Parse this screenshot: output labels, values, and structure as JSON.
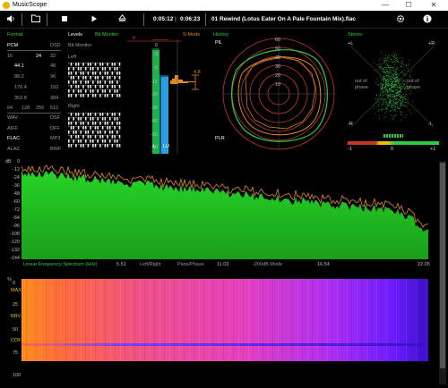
{
  "window": {
    "title": "MusicScope",
    "minimize": "—",
    "maximize": "☐",
    "close": "✕"
  },
  "toolbar": {
    "time_current": "0:05:12",
    "time_separator": "|",
    "time_total": "0:06:23",
    "track": "01 Rewind (Lotus Eater On A Pale Fountain Mix).flac"
  },
  "format": {
    "title": "Format",
    "header": [
      "PCM",
      "DSD"
    ],
    "bitdepth_row": [
      "16",
      "24",
      "32"
    ],
    "rates_left": [
      "44.1",
      "88.2",
      "176.4",
      "352.8"
    ],
    "rates_right": [
      "48",
      "96",
      "192",
      "384"
    ],
    "dsd_row": [
      "64",
      "128",
      "256",
      "512"
    ],
    "codecs_left": [
      "WAV",
      "AIFF",
      "FLAC",
      "ALAC"
    ],
    "codecs_right": [
      "DSF",
      "DFF",
      "MP3",
      "BWF"
    ]
  },
  "levels": {
    "title": "Levels",
    "bit_monitor": "Bit Monitor",
    "left": "Left",
    "right": "Right",
    "ticks": [
      "0",
      "-3",
      "-6",
      "-12",
      "-20",
      "-30",
      "-40",
      "-50",
      "-60"
    ],
    "peak_readout": "4.8",
    "mode_marker": "0",
    "mode_label": "S-Mode",
    "channel_l": "L",
    "channel_r": "LU"
  },
  "history": {
    "title": "History",
    "pll": "PlL",
    "plr": "PLR",
    "rings": [
      "10",
      "20",
      "30",
      "40",
      "50",
      "60"
    ]
  },
  "stereo": {
    "title": "Stereo",
    "plus_l": "+L",
    "plus_r": "+R",
    "minus_r": "-R",
    "minus_l": "-L",
    "out_of_phase_left": "out of phase",
    "out_of_phase_right": "out of phase",
    "balance_left": "-1",
    "balance_center": "0",
    "balance_right": "+1"
  },
  "spectrum": {
    "unit": "dB",
    "y_ticks": [
      "0",
      "-12",
      "-24",
      "-36",
      "-48",
      "-60",
      "-72",
      "-84",
      "-96",
      "-108",
      "-120",
      "-132",
      "-144"
    ],
    "x_ticks": [
      "5.51",
      "11.03",
      "16.54",
      "22.05"
    ],
    "label": "Linear Frequency Spectrum (kHz)",
    "left_right": "Left/Right",
    "pans_phase": "Pans/Phase",
    "mode": "-200dB Mode"
  },
  "spectrogram": {
    "y_ticks": [
      "%",
      "0",
      "25",
      "50",
      "75",
      "100"
    ],
    "markers": [
      "MAX",
      "BRV",
      "COF"
    ]
  }
}
